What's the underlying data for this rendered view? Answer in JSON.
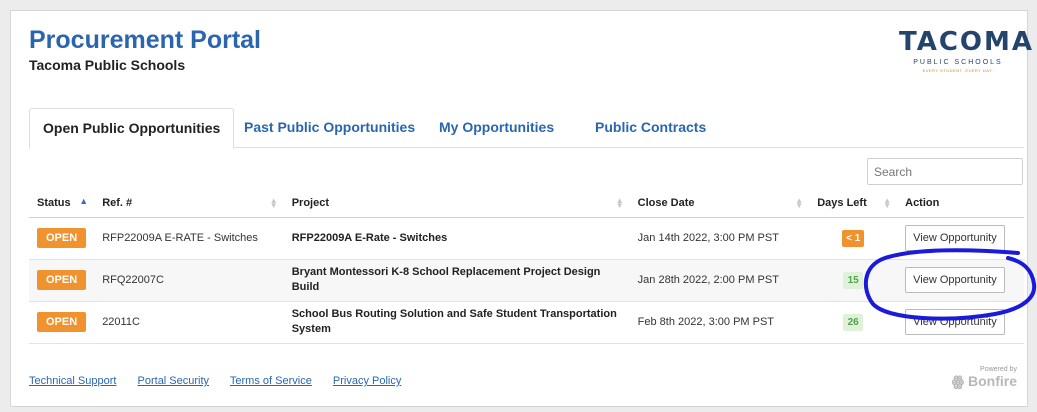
{
  "header": {
    "title": "Procurement Portal",
    "subtitle": "Tacoma Public Schools",
    "logo": {
      "word": "TACOMA",
      "sub": "PUBLIC SCHOOLS",
      "tag": "EVERY STUDENT. EVERY DAY."
    }
  },
  "tabs": [
    {
      "label": "Open Public Opportunities",
      "active": true
    },
    {
      "label": "Past Public Opportunities",
      "active": false
    },
    {
      "label": "My Opportunities",
      "active": false
    },
    {
      "label": "Public Contracts",
      "active": false
    }
  ],
  "search": {
    "placeholder": "Search"
  },
  "table": {
    "columns": [
      "Status",
      "Ref. #",
      "Project",
      "Close Date",
      "Days Left",
      "Action"
    ],
    "rows": [
      {
        "status": "OPEN",
        "ref": "RFP22009A E-RATE - Switches",
        "project": "RFP22009A E-Rate - Switches",
        "close": "Jan 14th 2022, 3:00 PM PST",
        "days": "< 1",
        "action": "View Opportunity"
      },
      {
        "status": "OPEN",
        "ref": "RFQ22007C",
        "project": "Bryant Montessori K-8 School Replacement Project Design Build",
        "close": "Jan 28th 2022, 2:00 PM PST",
        "days": "15",
        "action": "View Opportunity"
      },
      {
        "status": "OPEN",
        "ref": "22011C",
        "project": "School Bus Routing Solution and Safe Student Transportation System",
        "close": "Feb 8th 2022, 3:00 PM PST",
        "days": "26",
        "action": "View Opportunity"
      }
    ]
  },
  "footer": {
    "links": [
      "Technical Support",
      "Portal Security",
      "Terms of Service",
      "Privacy Policy"
    ],
    "powered_label": "Powered by",
    "powered_brand": "Bonfire"
  },
  "colors": {
    "accent": "#2a66b0",
    "badge": "#f0932e",
    "annotation": "#1a1adb"
  }
}
